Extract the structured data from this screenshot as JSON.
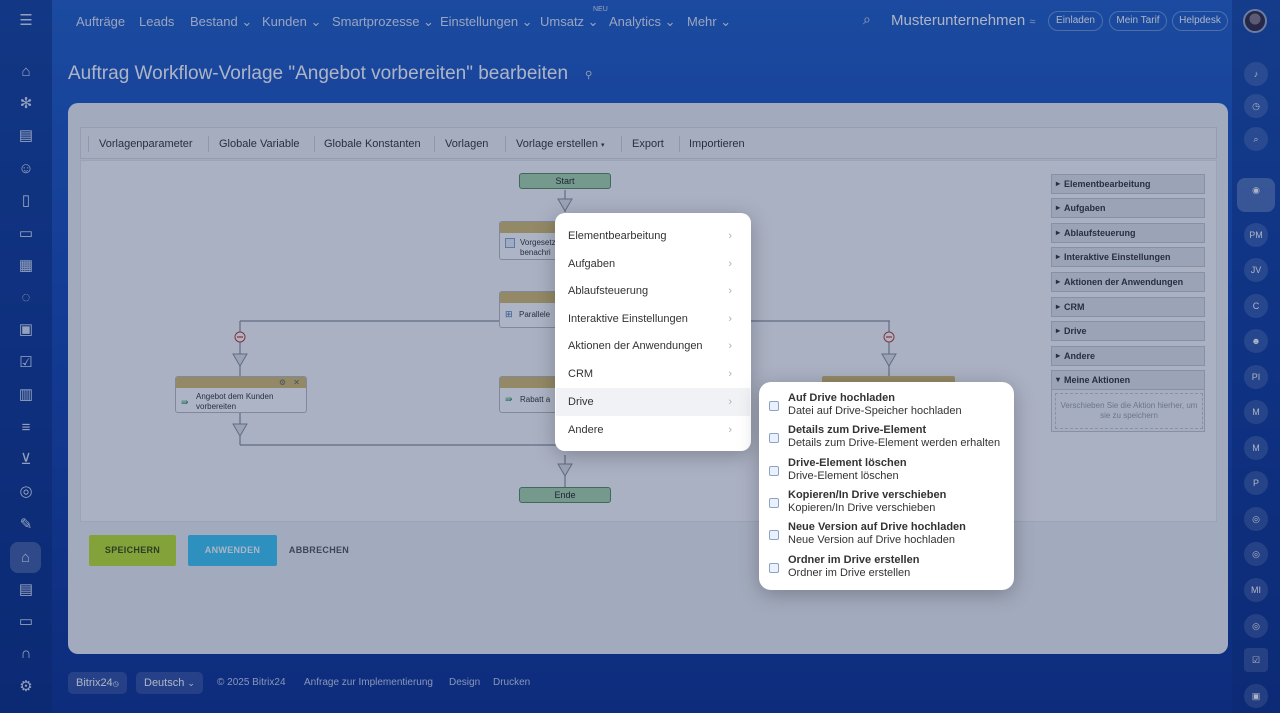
{
  "topnav": {
    "items": [
      "Aufträge",
      "Leads",
      "Bestand",
      "Kunden",
      "Smartprozesse",
      "Einstellungen",
      "Umsatz",
      "Analytics",
      "Mehr"
    ],
    "neu_badge": "NEU",
    "company": "Musterunternehmen",
    "invite": "Einladen",
    "tariff": "Mein Tarif",
    "helpdesk": "Helpdesk"
  },
  "page": {
    "title": "Auftrag Workflow-Vorlage \"Angebot vorbereiten\" bearbeiten"
  },
  "toolbar": {
    "items": [
      "Vorlagenparameter",
      "Globale Variable",
      "Globale Konstanten",
      "Vorlagen",
      "Vorlage erstellen",
      "Export",
      "Importieren"
    ]
  },
  "workflow": {
    "start": "Start",
    "end": "Ende",
    "node_notify": "Vorgesetz benachri",
    "node_parallel": "Parallele",
    "node_offer": "Angebot dem Kunden vorbereiten",
    "node_discount": "Rabatt a"
  },
  "right_panel": {
    "groups": [
      "Elementbearbeitung",
      "Aufgaben",
      "Ablaufsteuerung",
      "Interaktive Einstellungen",
      "Aktionen der Anwendungen",
      "CRM",
      "Drive",
      "Andere",
      "Meine Aktionen"
    ],
    "drop_hint": "Verschieben Sie die Aktion hierher, um sie zu speichern"
  },
  "buttons": {
    "save": "SPEICHERN",
    "apply": "ANWENDEN",
    "cancel": "ABBRECHEN"
  },
  "menu": {
    "items": [
      "Elementbearbeitung",
      "Aufgaben",
      "Ablaufsteuerung",
      "Interaktive Einstellungen",
      "Aktionen der Anwendungen",
      "CRM",
      "Drive",
      "Andere"
    ],
    "highlighted": "Drive"
  },
  "submenu": {
    "items": [
      {
        "title": "Auf Drive hochladen",
        "desc": "Datei auf Drive-Speicher hochladen"
      },
      {
        "title": "Details zum Drive-Element",
        "desc": "Details zum Drive-Element werden erhalten"
      },
      {
        "title": "Drive-Element löschen",
        "desc": "Drive-Element löschen"
      },
      {
        "title": "Kopieren/In Drive verschieben",
        "desc": "Kopieren/In Drive verschieben"
      },
      {
        "title": "Neue Version auf Drive hochladen",
        "desc": "Neue Version auf Drive hochladen"
      },
      {
        "title": "Ordner im Drive erstellen",
        "desc": "Ordner im Drive erstellen"
      }
    ]
  },
  "right_sidebar": {
    "avatars": [
      "PM",
      "JV",
      "C",
      "PI",
      "M",
      "M",
      "P",
      "MI"
    ]
  },
  "footer": {
    "brand": "Bitrix24",
    "language": "Deutsch",
    "copyright": "© 2025 Bitrix24",
    "links": [
      "Anfrage zur Implementierung",
      "Design",
      "Drucken"
    ]
  }
}
